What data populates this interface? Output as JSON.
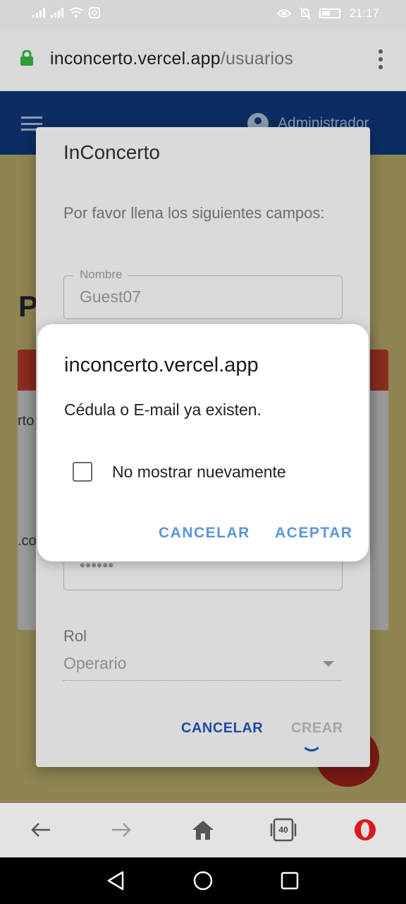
{
  "status": {
    "time": "21:17"
  },
  "browser": {
    "url_host": "inconcerto.vercel.app",
    "url_path": "/usuarios",
    "tabs_count": "40"
  },
  "app": {
    "admin_label": "Administrador"
  },
  "background": {
    "heading_fragment": "P",
    "row1_fragment": "rto",
    "row3_fragment": ".co"
  },
  "form_dialog": {
    "title": "InConcerto",
    "subtitle": "Por favor llena los siguientes campos:",
    "nombre_label": "Nombre",
    "nombre_value": "Guest07",
    "password_value": "••••••",
    "rol_label": "Rol",
    "rol_value": "Operario",
    "cancel_label": "CANCELAR",
    "create_label": "CREAR"
  },
  "alert": {
    "title": "inconcerto.vercel.app",
    "message": "Cédula o E-mail ya existen.",
    "checkbox_label": "No mostrar nuevamente",
    "cancel_label": "CANCELAR",
    "accept_label": "ACEPTAR"
  },
  "colors": {
    "app_header": "#0c2d63",
    "accent_link": "#5b94e0",
    "form_primary": "#1f4aa2",
    "opera_red": "#e0161e"
  }
}
